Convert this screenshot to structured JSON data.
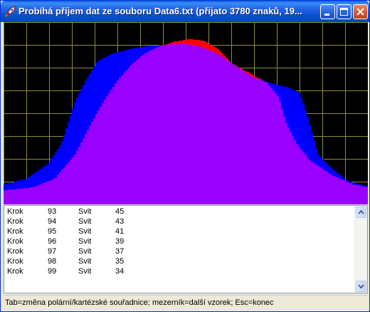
{
  "window": {
    "title": "Probíhá příjem dat ze souboru Data6.txt (přijato 3780 znaků, 19..."
  },
  "colors": {
    "plot_background": "#000000",
    "grid": "#8C8C3C",
    "series_a": "#0000FF",
    "series_b": "#FF0000",
    "overlap": "#9900FF"
  },
  "log": {
    "rows": [
      {
        "label": "Krok",
        "step": "93",
        "key": "Svit",
        "value": "45"
      },
      {
        "label": "Krok",
        "step": "94",
        "key": "Svit",
        "value": "43"
      },
      {
        "label": "Krok",
        "step": "95",
        "key": "Svit",
        "value": "41"
      },
      {
        "label": "Krok",
        "step": "96",
        "key": "Svit",
        "value": "39"
      },
      {
        "label": "Krok",
        "step": "97",
        "key": "Svit",
        "value": "37"
      },
      {
        "label": "Krok",
        "step": "98",
        "key": "Svit",
        "value": "35"
      },
      {
        "label": "Krok",
        "step": "99",
        "key": "Svit",
        "value": "34"
      }
    ]
  },
  "status": {
    "text": "Tab=změna polární/kartézské souřadnice;   mezerník=další vzorek;   Esc=konec"
  },
  "icons": {
    "app": "rocket-icon",
    "minimize": "minimize-icon",
    "maximize": "maximize-icon",
    "close": "close-icon",
    "scroll_up": "scroll-up-arrow-icon",
    "scroll_down": "scroll-down-arrow-icon"
  }
}
